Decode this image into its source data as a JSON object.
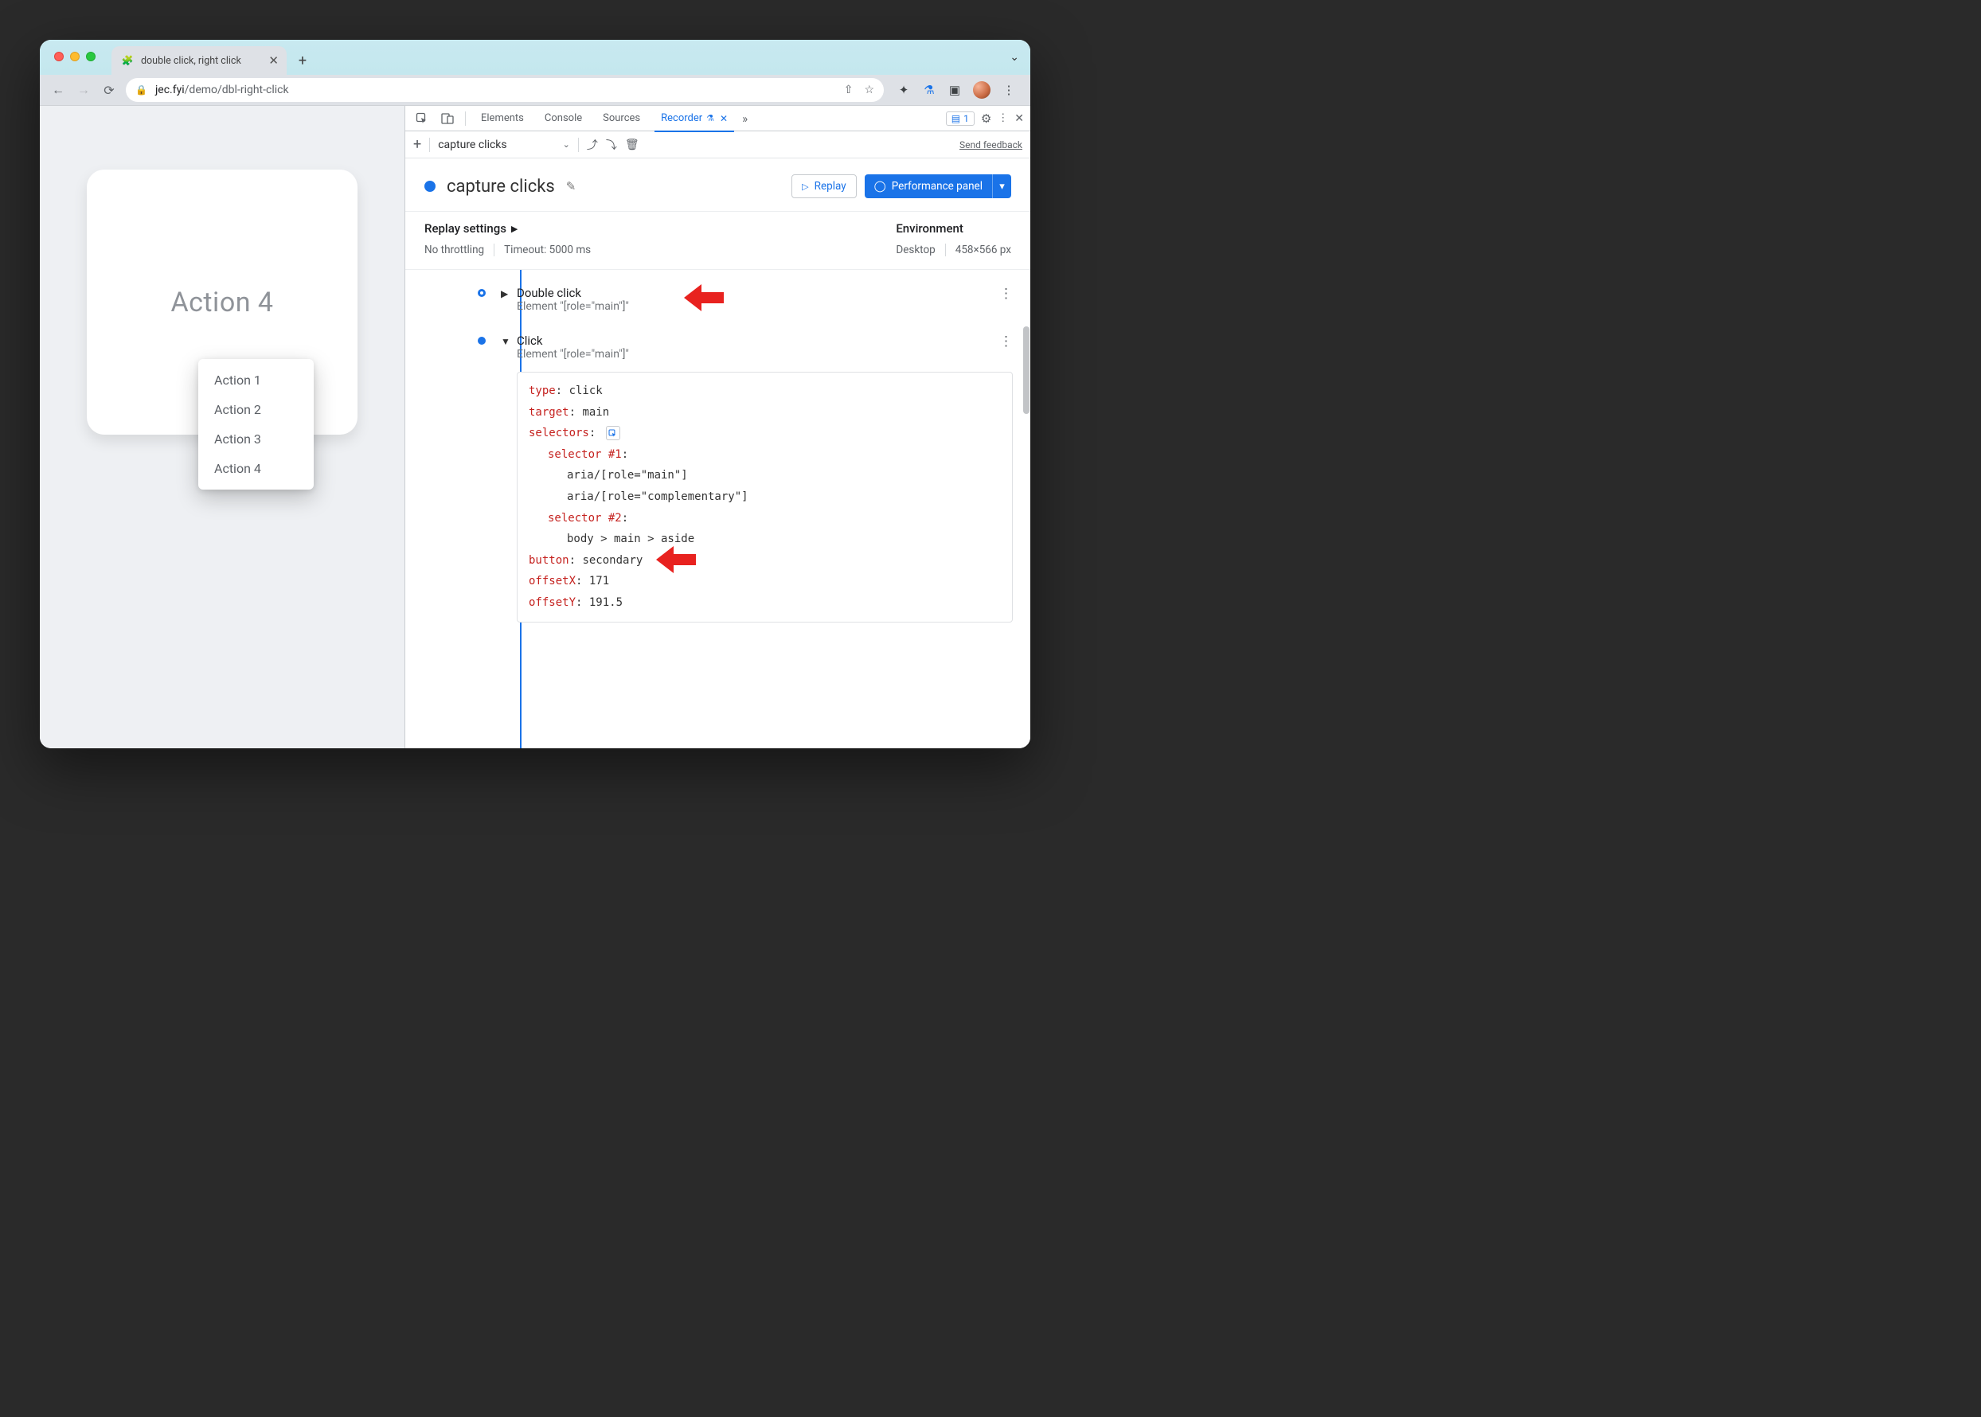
{
  "browser": {
    "tab_title": "double click, right click",
    "url_host": "jec.fyi",
    "url_path": "/demo/dbl-right-click"
  },
  "page": {
    "heading": "Action 4",
    "menu": [
      "Action 1",
      "Action 2",
      "Action 3",
      "Action 4"
    ]
  },
  "devtools": {
    "tabs": {
      "elements": "Elements",
      "console": "Console",
      "sources": "Sources",
      "recorder": "Recorder"
    },
    "issues_count": "1",
    "feedback": "Send feedback",
    "recording_name": "capture clicks",
    "replay_btn": "Replay",
    "perf_btn": "Performance panel",
    "settings": {
      "replay_label": "Replay settings",
      "throttling": "No throttling",
      "timeout": "Timeout: 5000 ms",
      "env_label": "Environment",
      "device": "Desktop",
      "dimensions": "458×566 px"
    },
    "steps": [
      {
        "title": "Double click",
        "sub": "Element \"[role=\"main\"]\"",
        "expanded": false
      },
      {
        "title": "Click",
        "sub": "Element \"[role=\"main\"]\"",
        "expanded": true,
        "props": {
          "type": "click",
          "target": "main",
          "selectors_label": "selectors",
          "s1_label": "selector #1",
          "s1_a": "aria/[role=\"main\"]",
          "s1_b": "aria/[role=\"complementary\"]",
          "s2_label": "selector #2",
          "s2_a": "body > main > aside",
          "button": "secondary",
          "offsetX": "171",
          "offsetY": "191.5"
        }
      }
    ]
  }
}
